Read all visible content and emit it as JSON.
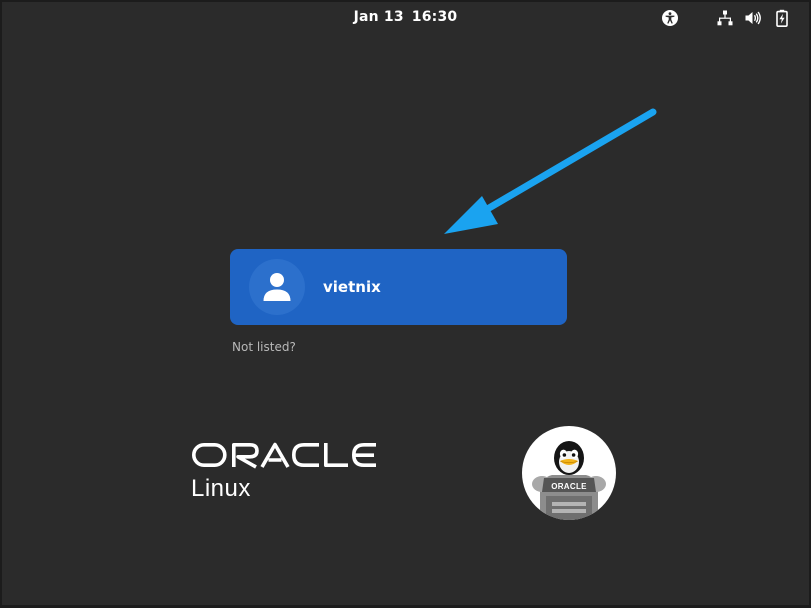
{
  "topbar": {
    "date": "Jan 13",
    "time": "16:30",
    "icons": [
      "accessibility-icon",
      "network-wired-icon",
      "volume-icon",
      "battery-charging-icon"
    ]
  },
  "login": {
    "users": [
      {
        "name": "vietnix",
        "avatar_icon": "user-avatar-icon"
      }
    ],
    "not_listed_label": "Not listed?"
  },
  "branding": {
    "logo_word": "ORACLE",
    "product": "Linux",
    "badge_text": "ORACLE"
  },
  "colors": {
    "background": "#2b2b2b",
    "user_card": "#1f64c4",
    "arrow": "#1aa3f0",
    "text_primary": "#ffffff",
    "text_secondary": "#b8b8b8"
  }
}
